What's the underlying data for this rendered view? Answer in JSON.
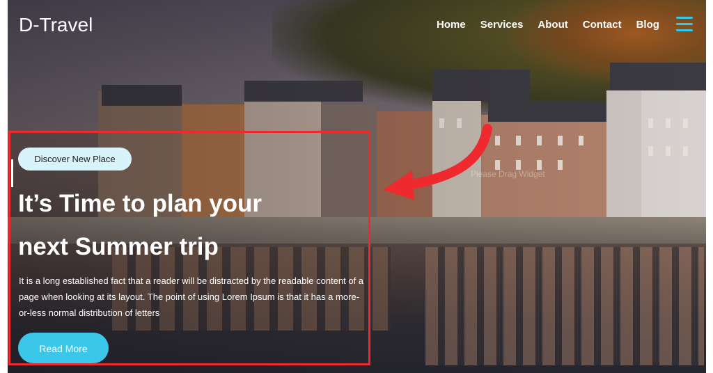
{
  "brand": {
    "logo_text": "D-Travel"
  },
  "nav": {
    "items": [
      {
        "label": "Home"
      },
      {
        "label": "Services"
      },
      {
        "label": "About"
      },
      {
        "label": "Contact"
      },
      {
        "label": "Blog"
      }
    ],
    "menu_icon": "hamburger-icon"
  },
  "hero": {
    "tag_label": "Discover New Place",
    "headline_line1": "It’s Time to plan your",
    "headline_line2": "next Summer trip",
    "description": "It is a long established fact that a reader will be distracted by the readable content of a page when looking at its layout. The point of using Lorem Ipsum is that it has a more-or-less normal distribution of letters",
    "cta_label": "Read More",
    "watermark": "Please Drag Widget"
  },
  "annotation": {
    "highlight_color": "#ee2a2e",
    "arrow": "curved-arrow-icon"
  },
  "colors": {
    "accent": "#3bc7ea",
    "tag_bg": "#d9f3fb",
    "text": "#ffffff"
  }
}
